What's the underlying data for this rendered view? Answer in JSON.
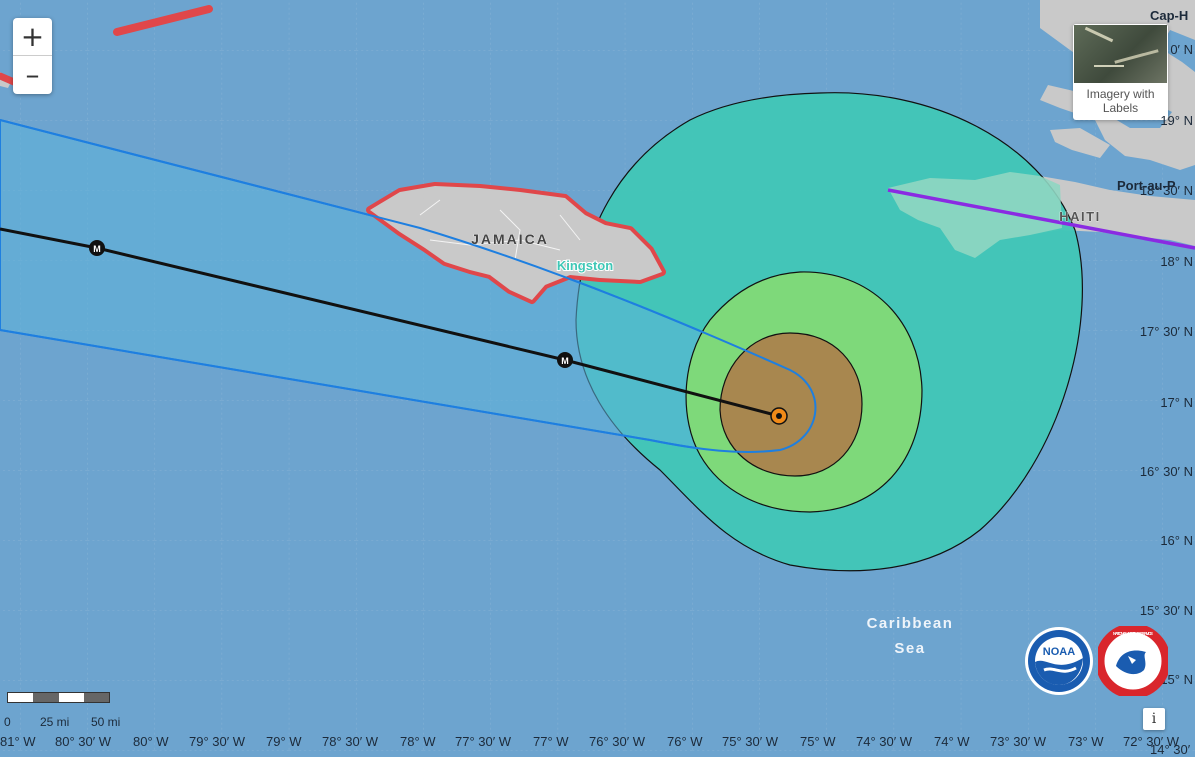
{
  "controls": {
    "zoom_in": "+",
    "zoom_out": "–",
    "basemap_label": "Imagery with Labels",
    "info": "i"
  },
  "labels": {
    "jamaica": "JAMAICA",
    "kingston": "Kingston",
    "haiti": "HAITI",
    "sea_line1": "Caribbean",
    "sea_line2": "Sea",
    "cap_haitien": "Cap-H",
    "port_au_prince": "Port-au-P"
  },
  "track_markers": [
    "M",
    "M"
  ],
  "latitudes": [
    "19° N",
    "18° 30′ N",
    "18° N",
    "17° 30′ N",
    "17° N",
    "16° 30′ N",
    "16° N",
    "15° 30′ N",
    "15° N"
  ],
  "latitude_partial_top": "0′ N",
  "longitudes": [
    "81° W",
    "80° 30′ W",
    "80° W",
    "79° 30′ W",
    "79° W",
    "78° 30′ W",
    "78° W",
    "77° 30′ W",
    "77° W",
    "76° 30′ W",
    "76° W",
    "75° 30′ W",
    "75° W",
    "74° 30′ W",
    "74° W",
    "73° 30′ W",
    "73° W",
    "72° 30′ W"
  ],
  "longitude_partial_right": "14° 30′",
  "scale": {
    "zero": "0",
    "mid": "25 mi",
    "end": "50 mi"
  },
  "logos": {
    "noaa": "NOAA",
    "nws": "NATIONAL WEATHER SERVICE"
  },
  "colors": {
    "ocean": "#6da4cf",
    "cone": "#5cb3db",
    "wind_34kt": "#3fc7b6",
    "wind_50kt": "#7ed97a",
    "wind_64kt": "#a8874f",
    "warning": "#e0474a",
    "watch_haiti": "#8a2be2",
    "track": "#111111",
    "land": "#c9c9c9"
  }
}
